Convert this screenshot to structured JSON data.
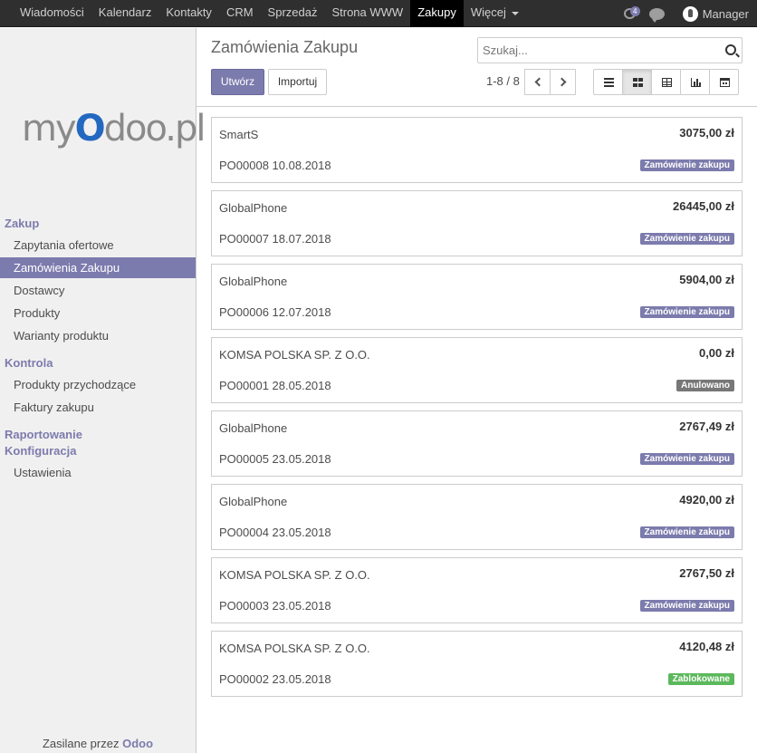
{
  "colors": {
    "accent": "#7c7bad",
    "cancelled": "#777777",
    "locked": "#5cb85c",
    "navbar": "#2f2f2f"
  },
  "navbar": {
    "menu": [
      "Wiadomości",
      "Kalendarz",
      "Kontakty",
      "CRM",
      "Sprzedaż",
      "Strona WWW",
      "Zakupy",
      "Więcej"
    ],
    "active": "Zakupy",
    "messages_badge": "4",
    "user_name": "Manager",
    "icons": [
      "messages-icon",
      "chat-icon",
      "user-avatar"
    ]
  },
  "sidebar": {
    "logo_text": "myOdoo.pl",
    "sections": [
      {
        "title": "Zakup",
        "items": [
          "Zapytania ofertowe",
          "Zamówienia Zakupu",
          "Dostawcy",
          "Produkty",
          "Warianty produktu"
        ]
      },
      {
        "title": "Kontrola",
        "items": [
          "Produkty przychodzące",
          "Faktury zakupu"
        ]
      },
      {
        "title": "Raportowanie",
        "items": []
      },
      {
        "title": "Konfiguracja",
        "items": [
          "Ustawienia"
        ]
      }
    ],
    "active_item": "Zamówienia Zakupu",
    "powered_by": "Zasilane przez",
    "powered_brand": "Odoo"
  },
  "control_panel": {
    "title": "Zamówienia Zakupu",
    "search_placeholder": "Szukaj...",
    "create_label": "Utwórz",
    "import_label": "Importuj",
    "pager": "1-8 / 8",
    "views": [
      "list",
      "kanban",
      "pivot",
      "graph",
      "calendar"
    ],
    "active_view": "kanban"
  },
  "orders": [
    {
      "partner": "SmartS",
      "amount": "3075,00 zł",
      "ref": "PO00008 10.08.2018",
      "status": "Zamówienie zakupu",
      "status_color": "#7c7bad"
    },
    {
      "partner": "GlobalPhone",
      "amount": "26445,00 zł",
      "ref": "PO00007 18.07.2018",
      "status": "Zamówienie zakupu",
      "status_color": "#7c7bad"
    },
    {
      "partner": "GlobalPhone",
      "amount": "5904,00 zł",
      "ref": "PO00006 12.07.2018",
      "status": "Zamówienie zakupu",
      "status_color": "#7c7bad"
    },
    {
      "partner": "KOMSA POLSKA SP. Z O.O.",
      "amount": "0,00 zł",
      "ref": "PO00001 28.05.2018",
      "status": "Anulowano",
      "status_color": "#777777"
    },
    {
      "partner": "GlobalPhone",
      "amount": "2767,49 zł",
      "ref": "PO00005 23.05.2018",
      "status": "Zamówienie zakupu",
      "status_color": "#7c7bad"
    },
    {
      "partner": "GlobalPhone",
      "amount": "4920,00 zł",
      "ref": "PO00004 23.05.2018",
      "status": "Zamówienie zakupu",
      "status_color": "#7c7bad"
    },
    {
      "partner": "KOMSA POLSKA SP. Z O.O.",
      "amount": "2767,50 zł",
      "ref": "PO00003 23.05.2018",
      "status": "Zamówienie zakupu",
      "status_color": "#7c7bad"
    },
    {
      "partner": "KOMSA POLSKA SP. Z O.O.",
      "amount": "4120,48 zł",
      "ref": "PO00002 23.05.2018",
      "status": "Zablokowane",
      "status_color": "#5cb85c"
    }
  ]
}
